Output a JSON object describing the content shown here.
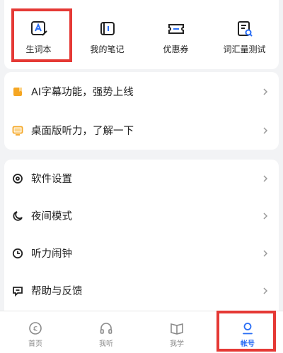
{
  "shortcuts": [
    {
      "label": "生词本",
      "icon": "vocabulary-book-icon"
    },
    {
      "label": "我的笔记",
      "icon": "notes-icon"
    },
    {
      "label": "优惠券",
      "icon": "coupon-icon"
    },
    {
      "label": "词汇量测试",
      "icon": "vocab-test-icon"
    }
  ],
  "promo": [
    {
      "label": "AI字幕功能，强势上线",
      "icon": "ai-subtitle-icon"
    },
    {
      "label": "桌面版听力，了解一下",
      "icon": "desktop-icon"
    }
  ],
  "settings": [
    {
      "label": "软件设置",
      "icon": "settings-icon"
    },
    {
      "label": "夜间模式",
      "icon": "moon-icon"
    },
    {
      "label": "听力闹钟",
      "icon": "clock-icon"
    },
    {
      "label": "帮助与反馈",
      "icon": "feedback-icon"
    }
  ],
  "tabs": [
    {
      "label": "首页",
      "icon": "home-icon",
      "active": false
    },
    {
      "label": "我听",
      "icon": "headphones-icon",
      "active": false
    },
    {
      "label": "我学",
      "icon": "book-icon",
      "active": false
    },
    {
      "label": "帐号",
      "icon": "account-icon",
      "active": true
    }
  ],
  "colors": {
    "accent": "#2a6ef5",
    "highlight": "#e53935",
    "promo_orange": "#f5a623"
  }
}
